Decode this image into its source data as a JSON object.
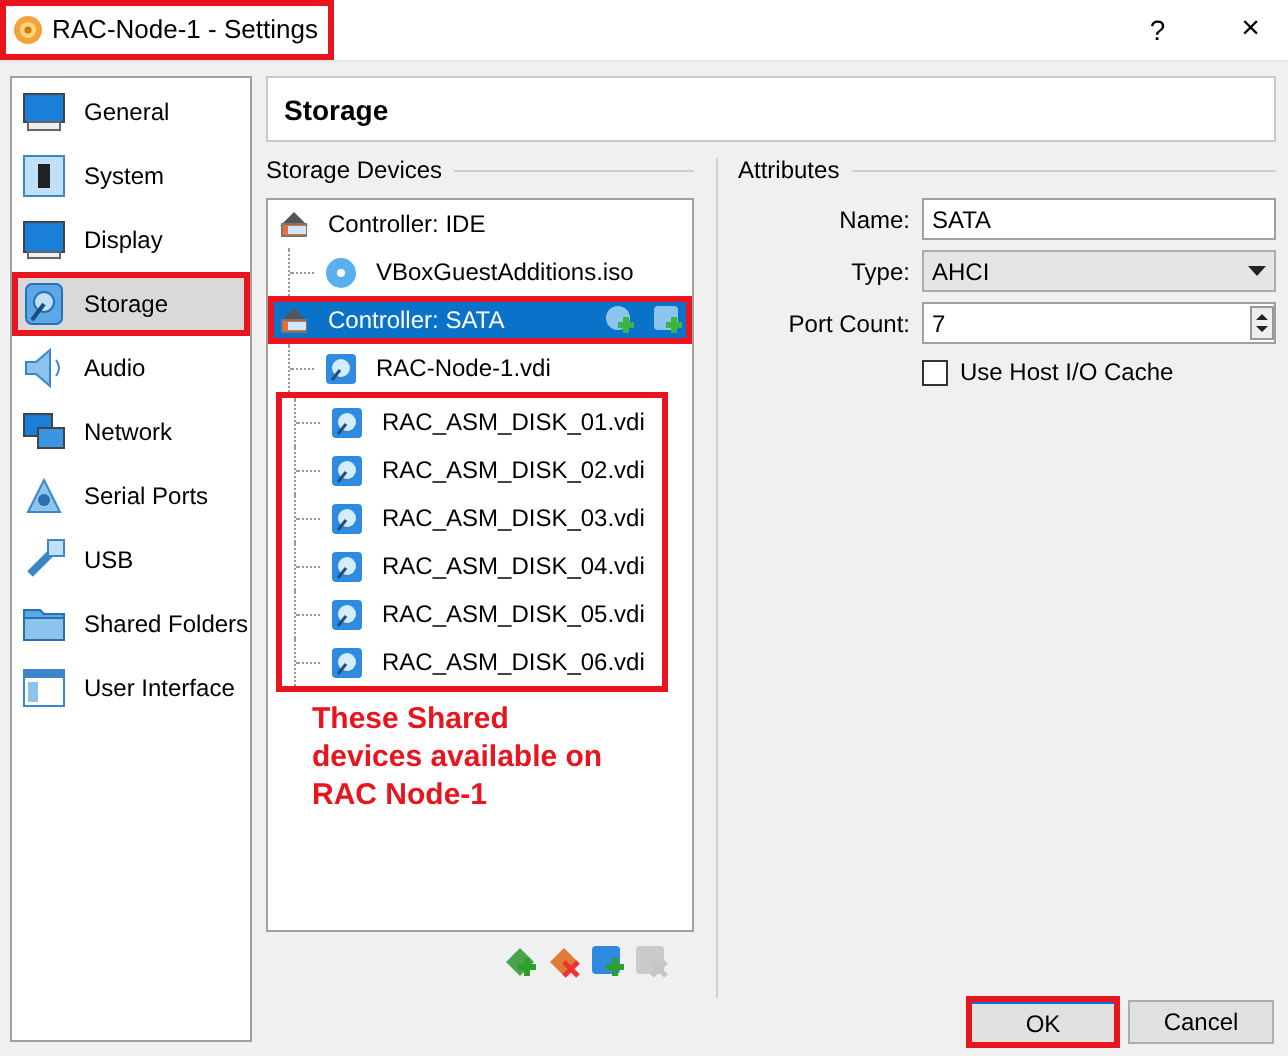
{
  "window": {
    "title": "RAC-Node-1 - Settings",
    "title_highlighted": true,
    "help": "?",
    "close": "×"
  },
  "sidebar": {
    "items": [
      {
        "label": "General",
        "kind": "general",
        "selected": false,
        "highlighted": false
      },
      {
        "label": "System",
        "kind": "system",
        "selected": false,
        "highlighted": false
      },
      {
        "label": "Display",
        "kind": "display",
        "selected": false,
        "highlighted": false
      },
      {
        "label": "Storage",
        "kind": "storage",
        "selected": true,
        "highlighted": true
      },
      {
        "label": "Audio",
        "kind": "audio",
        "selected": false,
        "highlighted": false
      },
      {
        "label": "Network",
        "kind": "network",
        "selected": false,
        "highlighted": false
      },
      {
        "label": "Serial Ports",
        "kind": "serial",
        "selected": false,
        "highlighted": false
      },
      {
        "label": "USB",
        "kind": "usb",
        "selected": false,
        "highlighted": false
      },
      {
        "label": "Shared Folders",
        "kind": "shared",
        "selected": false,
        "highlighted": false
      },
      {
        "label": "User Interface",
        "kind": "ui",
        "selected": false,
        "highlighted": false
      }
    ]
  },
  "page_title": "Storage",
  "storage_devices": {
    "title": "Storage Devices",
    "controllers": [
      {
        "name": "Controller: IDE",
        "selected": false,
        "highlighted": false,
        "attachments": [
          {
            "name": "VBoxGuestAdditions.iso",
            "kind": "optical",
            "grouped": false
          }
        ]
      },
      {
        "name": "Controller: SATA",
        "selected": true,
        "highlighted": true,
        "attachments": [
          {
            "name": "RAC-Node-1.vdi",
            "kind": "disk",
            "grouped": false
          },
          {
            "name": "RAC_ASM_DISK_01.vdi",
            "kind": "disk",
            "grouped": true
          },
          {
            "name": "RAC_ASM_DISK_02.vdi",
            "kind": "disk",
            "grouped": true
          },
          {
            "name": "RAC_ASM_DISK_03.vdi",
            "kind": "disk",
            "grouped": true
          },
          {
            "name": "RAC_ASM_DISK_04.vdi",
            "kind": "disk",
            "grouped": true
          },
          {
            "name": "RAC_ASM_DISK_05.vdi",
            "kind": "disk",
            "grouped": true
          },
          {
            "name": "RAC_ASM_DISK_06.vdi",
            "kind": "disk",
            "grouped": true
          }
        ]
      }
    ],
    "annotation": "These Shared devices available on RAC Node-1",
    "toolbar": [
      {
        "kind": "add_controller",
        "disabled": false
      },
      {
        "kind": "remove_controller",
        "disabled": false
      },
      {
        "kind": "add_attachment",
        "disabled": false
      },
      {
        "kind": "remove_attachment",
        "disabled": true
      }
    ]
  },
  "attributes": {
    "title": "Attributes",
    "name": {
      "label": "Name:",
      "value": "SATA"
    },
    "type": {
      "label": "Type:",
      "value": "AHCI"
    },
    "port_count": {
      "label": "Port Count:",
      "value": "7"
    },
    "host_io_cache": {
      "label": "Use Host I/O Cache",
      "checked": false
    }
  },
  "buttons": [
    {
      "label": "OK",
      "highlighted": true
    },
    {
      "label": "Cancel",
      "highlighted": false
    }
  ]
}
